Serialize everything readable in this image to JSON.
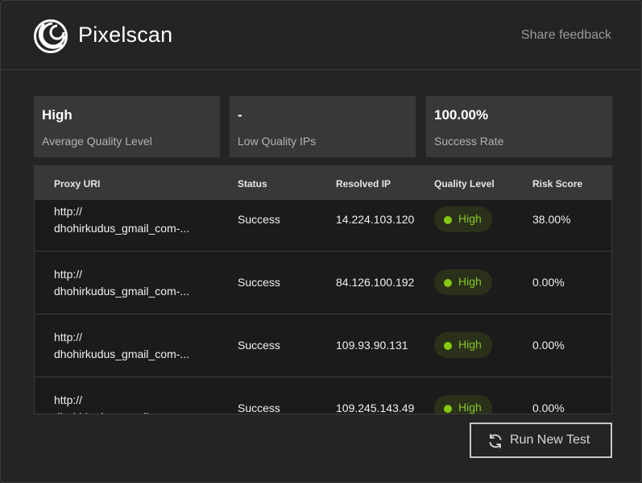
{
  "header": {
    "brand": "Pixelscan",
    "logo_icon": "pixelscan-logo-icon",
    "share_feedback": "Share feedback"
  },
  "summary": [
    {
      "value": "High",
      "label": "Average Quality Level"
    },
    {
      "value": "-",
      "label": "Low Quality IPs"
    },
    {
      "value": "100.00%",
      "label": "Success Rate"
    }
  ],
  "table": {
    "columns": [
      "Proxy URI",
      "Status",
      "Resolved IP",
      "Quality Level",
      "Risk Score"
    ],
    "rows": [
      {
        "uri_line1": "http://",
        "uri_line2": "dhohirkudus_gmail_com-...",
        "status": "Success",
        "ip": "14.224.103.120",
        "quality": "High",
        "risk": "38.00%"
      },
      {
        "uri_line1": "http://",
        "uri_line2": "dhohirkudus_gmail_com-...",
        "status": "Success",
        "ip": "84.126.100.192",
        "quality": "High",
        "risk": "0.00%"
      },
      {
        "uri_line1": "http://",
        "uri_line2": "dhohirkudus_gmail_com-...",
        "status": "Success",
        "ip": "109.93.90.131",
        "quality": "High",
        "risk": "0.00%"
      },
      {
        "uri_line1": "http://",
        "uri_line2": "dhohirkudus_gmail_com-...",
        "status": "Success",
        "ip": "109.245.143.49",
        "quality": "High",
        "risk": "0.00%"
      }
    ]
  },
  "colors": {
    "quality_high": "#86c80f",
    "background": "#242424",
    "card": "#383838"
  },
  "actions": {
    "run_new_test": "Run New Test",
    "run_icon": "refresh-icon"
  }
}
